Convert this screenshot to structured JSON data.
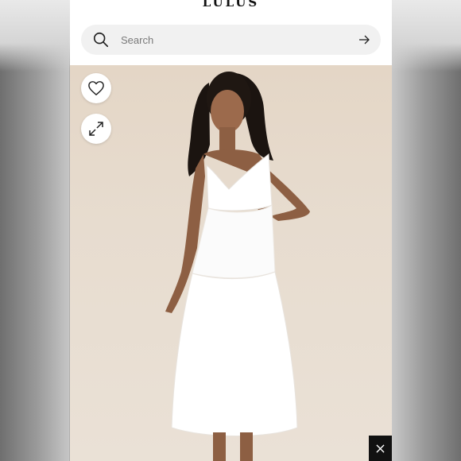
{
  "app": {
    "logo_text": "LULUS"
  },
  "search": {
    "placeholder": "Search",
    "value": ""
  },
  "icons": {
    "search": "search-icon",
    "submit": "arrow-right-icon",
    "favorite": "heart-icon",
    "expand": "expand-icon",
    "close": "close-icon"
  },
  "colors": {
    "background_tan": "#e4d6c6",
    "search_bg": "#f1f1f1",
    "dress": "#ffffff",
    "close_chip": "#111111"
  }
}
